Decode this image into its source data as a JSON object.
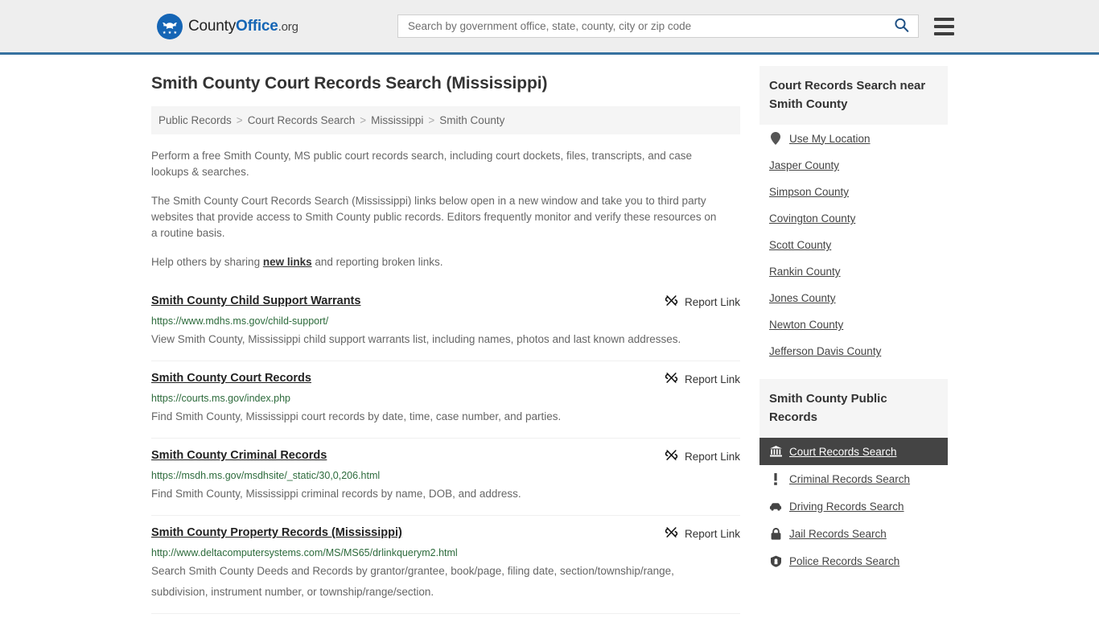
{
  "header": {
    "logo_name_part1": "County",
    "logo_name_part2": "Office",
    "logo_name_part3": ".org",
    "logo_icon": "eagle-seal-icon",
    "search_placeholder": "Search by government office, state, county, city or zip code",
    "search_value": "",
    "search_icon": "search-icon",
    "menu_icon": "hamburger-menu-icon",
    "accent_color": "#36719f",
    "brand_blue": "#1565b5"
  },
  "page": {
    "title": "Smith County Court Records Search (Mississippi)"
  },
  "breadcrumb": {
    "separator": ">",
    "items": [
      {
        "label": "Public Records"
      },
      {
        "label": "Court Records Search"
      },
      {
        "label": "Mississippi"
      },
      {
        "label": "Smith County"
      }
    ]
  },
  "intro": {
    "paragraph1": "Perform a free Smith County, MS public court records search, including court dockets, files, transcripts, and case lookups & searches.",
    "paragraph2": "The Smith County Court Records Search (Mississippi) links below open in a new window and take you to third party websites that provide access to Smith County public records. Editors frequently monitor and verify these resources on a routine basis.",
    "paragraph3_before": "Help others by sharing ",
    "paragraph3_link": "new links",
    "paragraph3_after": " and reporting broken links."
  },
  "results": {
    "report_label": "Report Link",
    "report_icon": "broken-link-icon",
    "items": [
      {
        "title": "Smith County Child Support Warrants",
        "url": "https://www.mdhs.ms.gov/child-support/",
        "description": "View Smith County, Mississippi child support warrants list, including names, photos and last known addresses."
      },
      {
        "title": "Smith County Court Records",
        "url": "https://courts.ms.gov/index.php",
        "description": "Find Smith County, Mississippi court records by date, time, case number, and parties."
      },
      {
        "title": "Smith County Criminal Records",
        "url": "https://msdh.ms.gov/msdhsite/_static/30,0,206.html",
        "description": "Find Smith County, Mississippi criminal records by name, DOB, and address."
      },
      {
        "title": "Smith County Property Records (Mississippi)",
        "url": "http://www.deltacomputersystems.com/MS/MS65/drlinkquerym2.html",
        "description": "Search Smith County Deeds and Records by grantor/grantee, book/page, filing date, section/township/range, subdivision, instrument number, or township/range/section."
      }
    ]
  },
  "sidebar": {
    "nearby": {
      "heading": "Court Records Search near Smith County",
      "items": [
        {
          "label": "Use My Location",
          "icon": "map-pin-icon"
        },
        {
          "label": "Jasper County",
          "icon": ""
        },
        {
          "label": "Simpson County",
          "icon": ""
        },
        {
          "label": "Covington County",
          "icon": ""
        },
        {
          "label": "Scott County",
          "icon": ""
        },
        {
          "label": "Rankin County",
          "icon": ""
        },
        {
          "label": "Jones County",
          "icon": ""
        },
        {
          "label": "Newton County",
          "icon": ""
        },
        {
          "label": "Jefferson Davis County",
          "icon": ""
        }
      ]
    },
    "public_records": {
      "heading": "Smith County Public Records",
      "items": [
        {
          "label": "Court Records Search",
          "icon": "courthouse-icon",
          "active": true
        },
        {
          "label": "Criminal Records Search",
          "icon": "exclamation-icon",
          "active": false
        },
        {
          "label": "Driving Records Search",
          "icon": "car-icon",
          "active": false
        },
        {
          "label": "Jail Records Search",
          "icon": "lock-icon",
          "active": false
        },
        {
          "label": "Police Records Search",
          "icon": "police-badge-icon",
          "active": false
        }
      ]
    },
    "active_bg": "#444444"
  }
}
